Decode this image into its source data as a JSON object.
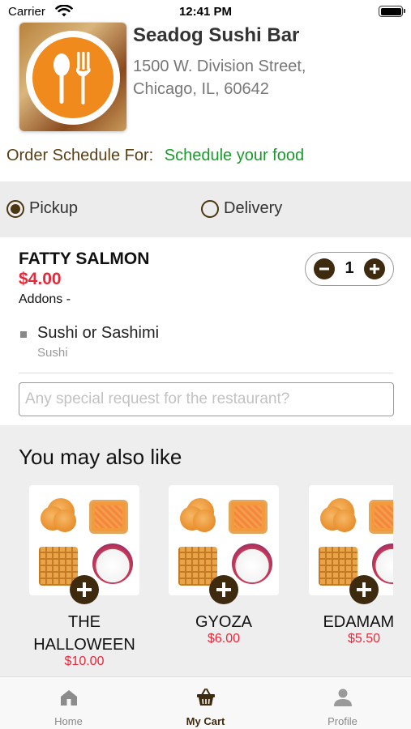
{
  "status_bar": {
    "carrier": "Carrier",
    "time": "12:41 PM"
  },
  "restaurant": {
    "name": "Seadog Sushi Bar",
    "address_line1": "1500 W. Division Street,",
    "address_line2": "Chicago, IL, 60642",
    "logo_icon": "fork-spoon-icon"
  },
  "schedule": {
    "label": "Order Schedule For:",
    "link": "Schedule your food"
  },
  "order_type": {
    "options": [
      {
        "label": "Pickup",
        "selected": true
      },
      {
        "label": "Delivery",
        "selected": false
      }
    ]
  },
  "cart_item": {
    "name": "FATTY SALMON",
    "price": "$4.00",
    "addons_label": "Addons -",
    "quantity": "1",
    "addon": {
      "name": "Sushi or Sashimi",
      "category": "Sushi"
    },
    "special_request_placeholder": "Any special request for the restaurant?"
  },
  "recommendations": {
    "title": "You may also like",
    "items": [
      {
        "name": "THE HALLOWEEN",
        "price": "$10.00"
      },
      {
        "name": "GYOZA",
        "price": "$6.00"
      },
      {
        "name": "EDAMAME",
        "price": "$5.50"
      }
    ]
  },
  "tabs": [
    {
      "label": "Home",
      "icon": "home-icon",
      "active": false
    },
    {
      "label": "My Cart",
      "icon": "basket-icon",
      "active": true
    },
    {
      "label": "Profile",
      "icon": "person-icon",
      "active": false
    }
  ],
  "colors": {
    "accent_brown": "#3e2a0e",
    "price_red": "#e8283a",
    "link_green": "#1a9a2a",
    "logo_orange": "#f08a1c"
  }
}
